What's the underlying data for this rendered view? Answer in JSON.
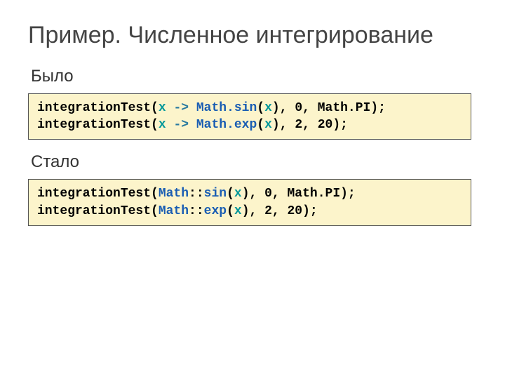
{
  "title": "Пример. Численное интегрирование",
  "section_before": "Было",
  "section_after": "Стало",
  "code_before": {
    "l1": {
      "pre": "integrationTest(",
      "x1": "x",
      "arrow": " -> ",
      "call": "Math.sin",
      "lp": "(",
      "x2": "x",
      "rp": ")",
      "tail": ", 0, Math.PI);"
    },
    "l2": {
      "pre": "integrationTest(",
      "x1": "x",
      "arrow": " -> ",
      "call": "Math.exp",
      "lp": "(",
      "x2": "x",
      "rp": ")",
      "tail": ", 2, 20);"
    }
  },
  "code_after": {
    "l1": {
      "pre": "integrationTest(",
      "cls": "Math",
      "sep": "::",
      "meth": "sin",
      "lp": "(",
      "x": "x",
      "rp": ")",
      "tail": ", 0, Math.PI);"
    },
    "l2": {
      "pre": "integrationTest(",
      "cls": "Math",
      "sep": "::",
      "meth": "exp",
      "lp": "(",
      "x": "x",
      "rp": ")",
      "tail": ", 2, 20);"
    }
  }
}
